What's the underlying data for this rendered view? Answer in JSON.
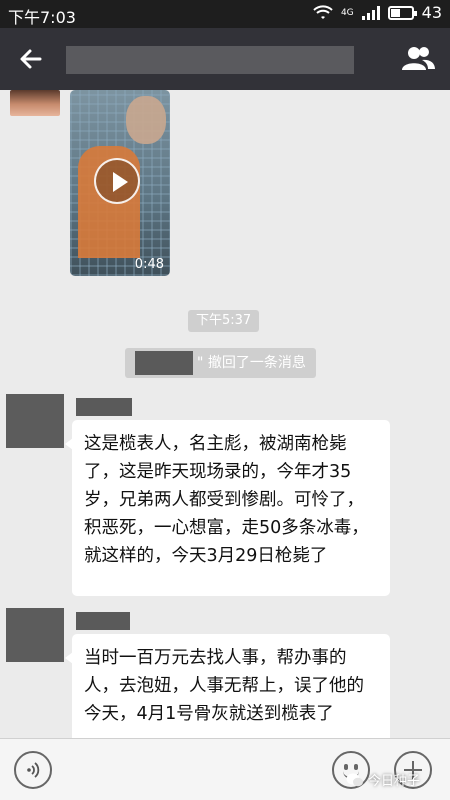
{
  "status_bar": {
    "time": "下午7:03",
    "signal_label": "4G",
    "battery_level": 0.43,
    "battery_text": "43"
  },
  "header": {
    "title": "",
    "back_icon": "arrow-left-icon",
    "menu_icon": "group-contacts-icon"
  },
  "messages": {
    "video": {
      "duration": "0:48"
    },
    "timestamp": "下午5:37",
    "recall_text": "\" 撤回了一条消息",
    "text1": "这是榄表人，名主彪，被湖南枪毙了，这是昨天现场录的，今年才35岁，兄弟两人都受到惨剧。可怜了，积恶死，一心想富，走50多条冰毒，就这样的，今天3月29日枪毙了",
    "text2": "当时一百万元去找人事，帮办事的人，去泡妞，人事无帮上，误了他的今天，4月1号骨灰就送到榄表了"
  },
  "input_bar": {
    "voice_icon": "voice-icon",
    "emoji_icon": "emoji-icon",
    "plus_icon": "plus-icon"
  },
  "watermark": {
    "text": "今日种子"
  },
  "colors": {
    "title_bar": "#323238",
    "chat_bg": "#ebebeb",
    "bubble_bg": "#ffffff",
    "redaction": "#5a5a5a"
  }
}
